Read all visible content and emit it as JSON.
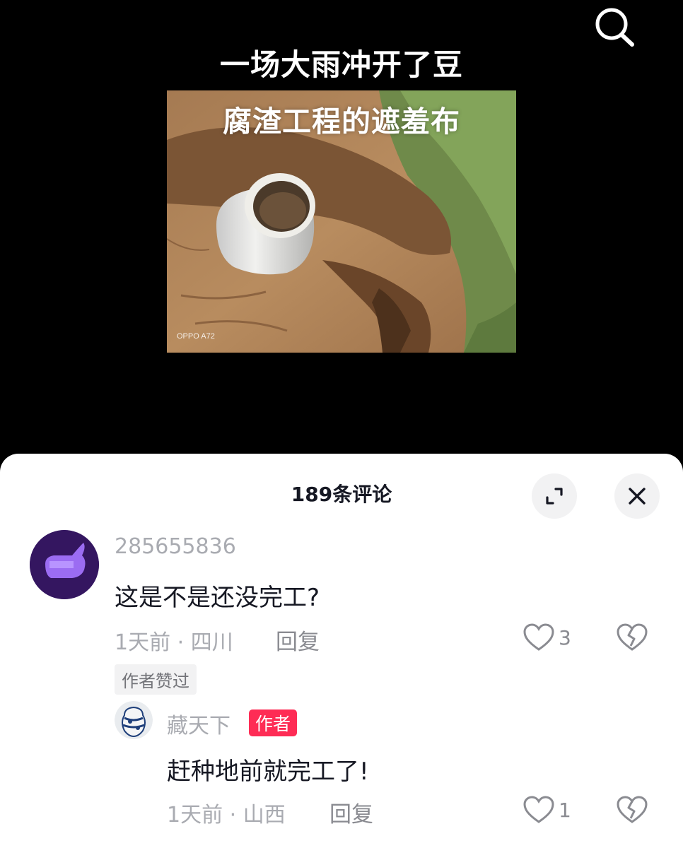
{
  "video": {
    "headline": "一场大雨冲开了豆",
    "photo_caption": "腐渣工程的遮羞布",
    "watermark": "OPPO A72"
  },
  "comments_panel": {
    "title": "189条评论"
  },
  "comments": [
    {
      "username": "285655836",
      "text": "这是不是还没完工?",
      "time_location": "1天前 · 四川",
      "reply_label": "回复",
      "likes": "3",
      "badge": "作者赞过"
    }
  ],
  "replies": [
    {
      "username": "藏天下",
      "author_tag": "作者",
      "text": "赶种地前就完工了!",
      "time_location": "1天前 · 山西",
      "reply_label": "回复",
      "likes": "1"
    }
  ],
  "colors": {
    "author_tag": "#fe2c55",
    "text_primary": "#161823",
    "text_secondary": "#a9abb1"
  },
  "icons": [
    "search-icon",
    "expand-icon",
    "close-icon",
    "heart-icon",
    "broken-heart-icon"
  ]
}
